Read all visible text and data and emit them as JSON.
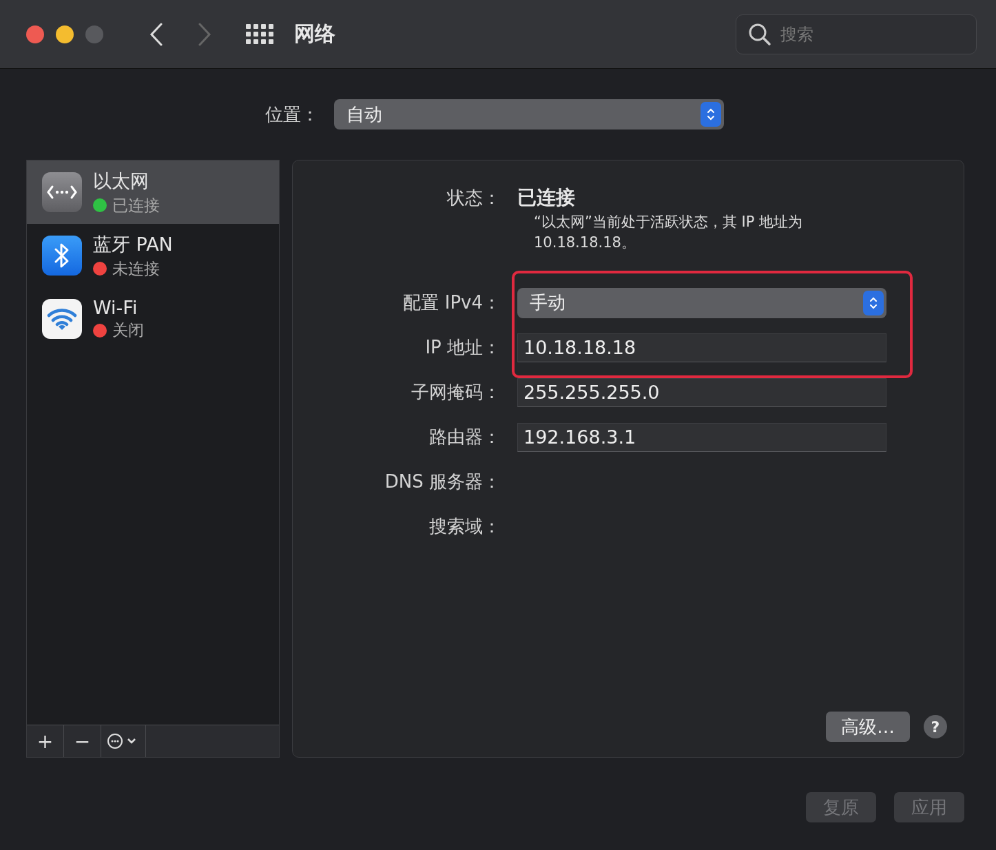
{
  "window": {
    "title": "网络",
    "search": {
      "placeholder": "搜索"
    }
  },
  "location": {
    "label": "位置：",
    "value": "自动"
  },
  "services": [
    {
      "name": "以太网",
      "status": "已连接",
      "color": "#2fc244",
      "kind": "ethernet",
      "selected": true
    },
    {
      "name": "蓝牙 PAN",
      "status": "未连接",
      "color": "#ef4340",
      "kind": "bluetooth",
      "selected": false
    },
    {
      "name": "Wi-Fi",
      "status": "关闭",
      "color": "#ef4340",
      "kind": "wifi",
      "selected": false
    }
  ],
  "service_toolbar": [
    "+",
    "−"
  ],
  "status": {
    "label": "状态：",
    "value": "已连接",
    "description": "“以太网”当前处于活跃状态，其 IP 地址为 10.18.18.18。"
  },
  "form_groups": [
    {
      "highlighted": true,
      "rows": [
        {
          "label": "配置 IPv4：",
          "kind": "popup",
          "value": "手动"
        },
        {
          "label": "IP 地址：",
          "kind": "field",
          "value": "10.18.18.18"
        }
      ]
    },
    {
      "highlighted": false,
      "rows": [
        {
          "label": "子网掩码：",
          "kind": "field",
          "value": "255.255.255.0"
        },
        {
          "label": "路由器：",
          "kind": "field",
          "value": "192.168.3.1"
        },
        {
          "label": "DNS 服务器：",
          "kind": "empty"
        },
        {
          "label": "搜索域：",
          "kind": "empty"
        }
      ]
    }
  ],
  "advanced_button": "高级…",
  "help_button": "?",
  "buttons": [
    {
      "label": "复原",
      "disabled": true
    },
    {
      "label": "应用",
      "disabled": true
    }
  ]
}
